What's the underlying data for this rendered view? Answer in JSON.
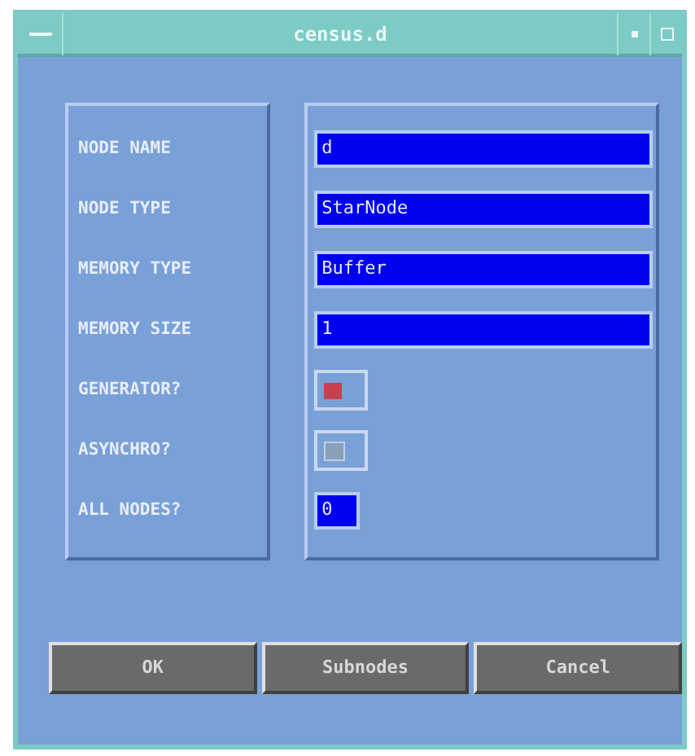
{
  "window": {
    "title": "census.d"
  },
  "rows": [
    {
      "kind": "text",
      "label": "NODE NAME",
      "value": "d"
    },
    {
      "kind": "text",
      "label": "NODE TYPE",
      "value": "StarNode"
    },
    {
      "kind": "text",
      "label": "MEMORY TYPE",
      "value": "Buffer"
    },
    {
      "kind": "text",
      "label": "MEMORY SIZE",
      "value": "1"
    },
    {
      "kind": "toggle",
      "label": "GENERATOR?",
      "checked": true
    },
    {
      "kind": "toggle",
      "label": "ASYNCHRO?",
      "checked": false
    },
    {
      "kind": "short",
      "label": "ALL NODES?",
      "value": "0"
    }
  ],
  "buttons": [
    "OK",
    "Subnodes",
    "Cancel"
  ]
}
